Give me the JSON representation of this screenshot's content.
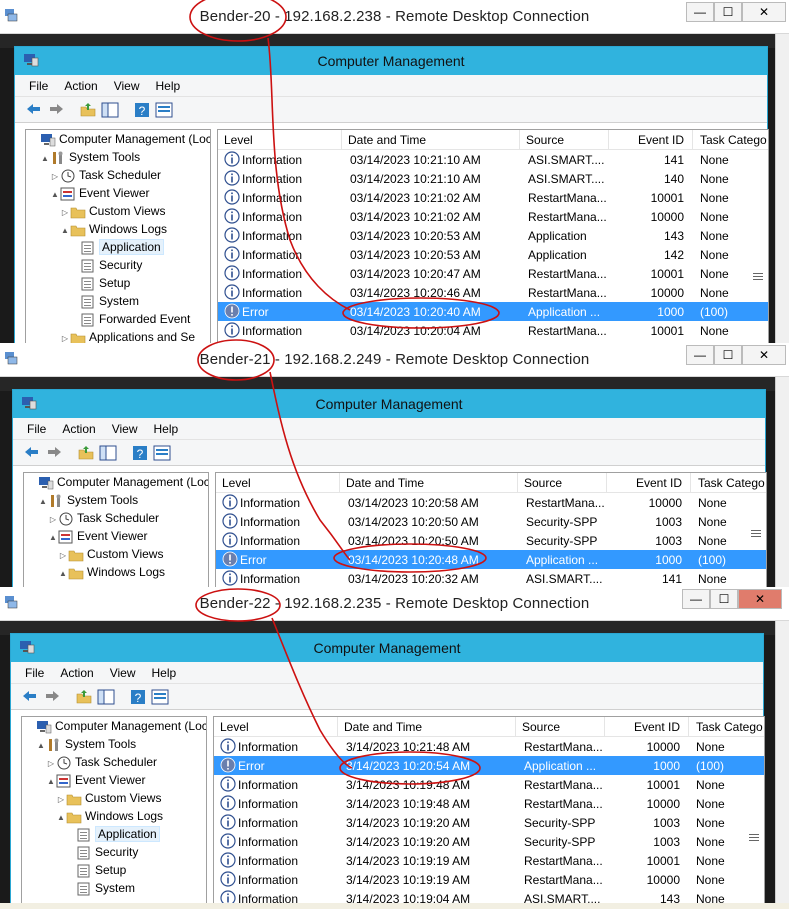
{
  "windows": [
    {
      "title": "Bender-20 - 192.168.2.238 - Remote Desktop Connection",
      "app_title": "Computer Management",
      "menu": [
        "File",
        "Action",
        "View",
        "Help"
      ],
      "tree": [
        {
          "label": "Computer Management (Local",
          "depth": 0,
          "arrow": "",
          "icon": "computer-icon"
        },
        {
          "label": "System Tools",
          "depth": 1,
          "arrow": "▲",
          "icon": "tools-icon"
        },
        {
          "label": "Task Scheduler",
          "depth": 2,
          "arrow": "▷",
          "icon": "clock-icon"
        },
        {
          "label": "Event Viewer",
          "depth": 2,
          "arrow": "▲",
          "icon": "event-viewer-icon"
        },
        {
          "label": "Custom Views",
          "depth": 3,
          "arrow": "▷",
          "icon": "folder-icon"
        },
        {
          "label": "Windows Logs",
          "depth": 3,
          "arrow": "▲",
          "icon": "folder-icon"
        },
        {
          "label": "Application",
          "depth": 4,
          "arrow": "",
          "icon": "log-icon",
          "selected": true
        },
        {
          "label": "Security",
          "depth": 4,
          "arrow": "",
          "icon": "log-icon"
        },
        {
          "label": "Setup",
          "depth": 4,
          "arrow": "",
          "icon": "log-icon"
        },
        {
          "label": "System",
          "depth": 4,
          "arrow": "",
          "icon": "log-icon"
        },
        {
          "label": "Forwarded Event",
          "depth": 4,
          "arrow": "",
          "icon": "log-icon"
        },
        {
          "label": "Applications and Se",
          "depth": 3,
          "arrow": "▷",
          "icon": "folder-icon"
        }
      ],
      "columns": [
        "Level",
        "Date and Time",
        "Source",
        "Event ID",
        "Task Catego"
      ],
      "rows": [
        {
          "level": "Information",
          "date": "03/14/2023 10:21:10 AM",
          "source": "ASI.SMART....",
          "id": "141",
          "task": "None"
        },
        {
          "level": "Information",
          "date": "03/14/2023 10:21:10 AM",
          "source": "ASI.SMART....",
          "id": "140",
          "task": "None"
        },
        {
          "level": "Information",
          "date": "03/14/2023 10:21:02 AM",
          "source": "RestartMana...",
          "id": "10001",
          "task": "None"
        },
        {
          "level": "Information",
          "date": "03/14/2023 10:21:02 AM",
          "source": "RestartMana...",
          "id": "10000",
          "task": "None"
        },
        {
          "level": "Information",
          "date": "03/14/2023 10:20:53 AM",
          "source": "Application",
          "id": "143",
          "task": "None"
        },
        {
          "level": "Information",
          "date": "03/14/2023 10:20:53 AM",
          "source": "Application",
          "id": "142",
          "task": "None"
        },
        {
          "level": "Information",
          "date": "03/14/2023 10:20:47 AM",
          "source": "RestartMana...",
          "id": "10001",
          "task": "None"
        },
        {
          "level": "Information",
          "date": "03/14/2023 10:20:46 AM",
          "source": "RestartMana...",
          "id": "10000",
          "task": "None"
        },
        {
          "level": "Error",
          "date": "03/14/2023 10:20:40 AM",
          "source": "Application ...",
          "id": "1000",
          "task": "(100)",
          "error": true
        },
        {
          "level": "Information",
          "date": "03/14/2023 10:20:04 AM",
          "source": "RestartMana...",
          "id": "10001",
          "task": "None"
        }
      ]
    },
    {
      "title": "Bender-21 - 192.168.2.249 - Remote Desktop Connection",
      "app_title": "Computer Management",
      "menu": [
        "File",
        "Action",
        "View",
        "Help"
      ],
      "tree": [
        {
          "label": "Computer Management (Local",
          "depth": 0,
          "arrow": "",
          "icon": "computer-icon"
        },
        {
          "label": "System Tools",
          "depth": 1,
          "arrow": "▲",
          "icon": "tools-icon"
        },
        {
          "label": "Task Scheduler",
          "depth": 2,
          "arrow": "▷",
          "icon": "clock-icon"
        },
        {
          "label": "Event Viewer",
          "depth": 2,
          "arrow": "▲",
          "icon": "event-viewer-icon"
        },
        {
          "label": "Custom Views",
          "depth": 3,
          "arrow": "▷",
          "icon": "folder-icon"
        },
        {
          "label": "Windows Logs",
          "depth": 3,
          "arrow": "▲",
          "icon": "folder-icon"
        }
      ],
      "columns": [
        "Level",
        "Date and Time",
        "Source",
        "Event ID",
        "Task Catego"
      ],
      "rows": [
        {
          "level": "Information",
          "date": "03/14/2023 10:20:58 AM",
          "source": "RestartMana...",
          "id": "10000",
          "task": "None"
        },
        {
          "level": "Information",
          "date": "03/14/2023 10:20:50 AM",
          "source": "Security-SPP",
          "id": "1003",
          "task": "None"
        },
        {
          "level": "Information",
          "date": "03/14/2023 10:20:50 AM",
          "source": "Security-SPP",
          "id": "1003",
          "task": "None"
        },
        {
          "level": "Error",
          "date": "03/14/2023 10:20:48 AM",
          "source": "Application ...",
          "id": "1000",
          "task": "(100)",
          "error": true
        },
        {
          "level": "Information",
          "date": "03/14/2023 10:20:32 AM",
          "source": "ASI.SMART....",
          "id": "141",
          "task": "None"
        }
      ]
    },
    {
      "title": "Bender-22 - 192.168.2.235 - Remote Desktop Connection",
      "app_title": "Computer Management",
      "menu": [
        "File",
        "Action",
        "View",
        "Help"
      ],
      "tree": [
        {
          "label": "Computer Management (Local",
          "depth": 0,
          "arrow": "",
          "icon": "computer-icon"
        },
        {
          "label": "System Tools",
          "depth": 1,
          "arrow": "▲",
          "icon": "tools-icon"
        },
        {
          "label": "Task Scheduler",
          "depth": 2,
          "arrow": "▷",
          "icon": "clock-icon"
        },
        {
          "label": "Event Viewer",
          "depth": 2,
          "arrow": "▲",
          "icon": "event-viewer-icon"
        },
        {
          "label": "Custom Views",
          "depth": 3,
          "arrow": "▷",
          "icon": "folder-icon"
        },
        {
          "label": "Windows Logs",
          "depth": 3,
          "arrow": "▲",
          "icon": "folder-icon"
        },
        {
          "label": "Application",
          "depth": 4,
          "arrow": "",
          "icon": "log-icon",
          "selected": true
        },
        {
          "label": "Security",
          "depth": 4,
          "arrow": "",
          "icon": "log-icon"
        },
        {
          "label": "Setup",
          "depth": 4,
          "arrow": "",
          "icon": "log-icon"
        },
        {
          "label": "System",
          "depth": 4,
          "arrow": "",
          "icon": "log-icon"
        }
      ],
      "columns": [
        "Level",
        "Date and Time",
        "Source",
        "Event ID",
        "Task Catego"
      ],
      "rows": [
        {
          "level": "Information",
          "date": "3/14/2023 10:21:48 AM",
          "source": "RestartMana...",
          "id": "10000",
          "task": "None"
        },
        {
          "level": "Error",
          "date": "3/14/2023 10:20:54 AM",
          "source": "Application ...",
          "id": "1000",
          "task": "(100)",
          "error": true
        },
        {
          "level": "Information",
          "date": "3/14/2023 10:19:48 AM",
          "source": "RestartMana...",
          "id": "10001",
          "task": "None"
        },
        {
          "level": "Information",
          "date": "3/14/2023 10:19:48 AM",
          "source": "RestartMana...",
          "id": "10000",
          "task": "None"
        },
        {
          "level": "Information",
          "date": "3/14/2023 10:19:20 AM",
          "source": "Security-SPP",
          "id": "1003",
          "task": "None"
        },
        {
          "level": "Information",
          "date": "3/14/2023 10:19:20 AM",
          "source": "Security-SPP",
          "id": "1003",
          "task": "None"
        },
        {
          "level": "Information",
          "date": "3/14/2023 10:19:19 AM",
          "source": "RestartMana...",
          "id": "10001",
          "task": "None"
        },
        {
          "level": "Information",
          "date": "3/14/2023 10:19:19 AM",
          "source": "RestartMana...",
          "id": "10000",
          "task": "None"
        },
        {
          "level": "Information",
          "date": "3/14/2023 10:19:04 AM",
          "source": "ASI.SMART....",
          "id": "143",
          "task": "None"
        }
      ]
    }
  ],
  "window_controls": {
    "minimize": "—",
    "maximize": "☐",
    "close": "✕"
  },
  "colors": {
    "title_bar": "#30b3de",
    "selected_row": "#3399ff",
    "annotation": "#cc1111",
    "close_red": "#e07c6c"
  }
}
